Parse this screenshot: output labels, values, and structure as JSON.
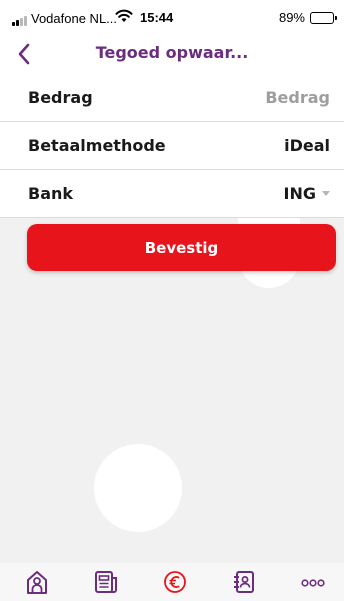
{
  "status_bar": {
    "carrier": "Vodafone NL...",
    "time": "15:44",
    "battery": "89%",
    "battery_level": 0.89,
    "signal_bars": 2
  },
  "nav": {
    "title": "Tegoed opwaar..."
  },
  "form": {
    "amount_label": "Bedrag",
    "amount_placeholder": "Bedrag",
    "method_label": "Betaalmethode",
    "method_value": "iDeal",
    "bank_label": "Bank",
    "bank_value": "ING"
  },
  "confirm_label": "Bevestig",
  "tabs": [
    {
      "icon": "home-icon"
    },
    {
      "icon": "news-icon"
    },
    {
      "icon": "euro-icon"
    },
    {
      "icon": "contacts-icon"
    },
    {
      "icon": "more-icon"
    }
  ],
  "colors": {
    "accent": "#6b2d7e",
    "button": "#e8141c",
    "background": "#f1f1f1"
  }
}
